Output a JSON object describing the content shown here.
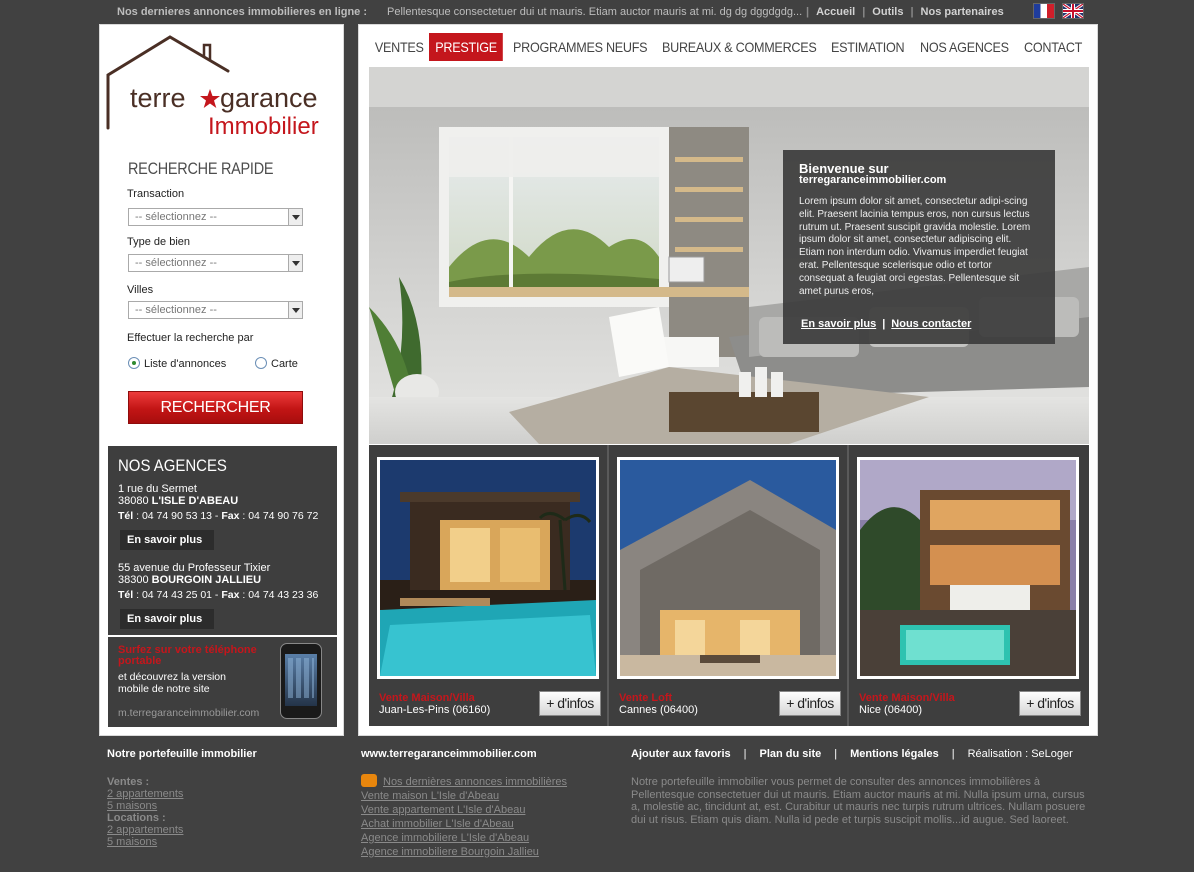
{
  "topbar": {
    "news_label": "Nos dernieres annonces immobilieres en ligne :",
    "news_text": "Pellentesque consectetuer dui ut mauris. Etiam auctor mauris at mi. dg dg dggdgdg...",
    "links": [
      "Accueil",
      "Outils",
      "Nos partenaires"
    ],
    "languages": [
      "fr",
      "en"
    ]
  },
  "logo": {
    "line1": "terre",
    "line2": "garance",
    "line3": "Immobilier"
  },
  "search": {
    "title": "RECHERCHE RAPIDE",
    "transaction_label": "Transaction",
    "transaction_value": "-- sélectionnez --",
    "type_label": "Type de bien",
    "type_value": "-- sélectionnez --",
    "villes_label": "Villes",
    "villes_value": "-- sélectionnez --",
    "mode_label": "Effectuer la recherche par",
    "mode_list": "Liste d'annonces",
    "mode_map": "Carte",
    "button": "RECHERCHER"
  },
  "agences": {
    "title": "NOS AGENCES",
    "items": [
      {
        "street": "1 rue du Sermet",
        "zip": "38080",
        "city": "L'ISLE D'ABEAU",
        "tel_label": "Tél",
        "tel": "04 74 90 53 13",
        "fax_label": "Fax",
        "fax": "04 74 90 76 72",
        "more": "En savoir plus"
      },
      {
        "street": "55 avenue du Professeur Tixier",
        "zip": "38300",
        "city": "BOURGOIN JALLIEU",
        "tel_label": "Tél",
        "tel": "04 74 43 25 01",
        "fax_label": "Fax",
        "fax": "04 74 43 23 36",
        "more": "En savoir plus"
      }
    ]
  },
  "mobile": {
    "headline": "Surfez sur votre téléphone portable",
    "text1": "et découvrez la version",
    "text2": "mobile de notre site",
    "url": "m.terregaranceimmobilier.com"
  },
  "nav": [
    "VENTES",
    "PRESTIGE",
    "PROGRAMMES NEUFS",
    "BUREAUX & COMMERCES",
    "ESTIMATION",
    "NOS AGENCES",
    "CONTACT"
  ],
  "welcome": {
    "title": "Bienvenue sur",
    "subtitle": "terregaranceimmobilier.com",
    "body": "Lorem ipsum dolor sit amet, consectetur adipi-scing elit. Praesent lacinia tempus eros, non cursus lectus rutrum ut. Praesent suscipit gravida molestie. Lorem ipsum dolor sit amet, consectetur adipiscing elit. Etiam non interdum odio. Vivamus imperdiet feugiat erat. Pellentesque scelerisque odio et tortor consequat a feugiat orci egestas. Pellentesque sit amet purus eros,",
    "link_more": "En savoir plus",
    "link_contact": "Nous contacter"
  },
  "properties": [
    {
      "type": "Vente Maison/Villa",
      "city": "Juan-Les-Pins (06160)",
      "button": "+ d'infos"
    },
    {
      "type": "Vente Loft",
      "city": "Cannes (06400)",
      "button": "+ d'infos"
    },
    {
      "type": "Vente Maison/Villa",
      "city": "Nice (06400)",
      "button": "+ d'infos"
    }
  ],
  "footer": {
    "col1_title": "Notre portefeuille immobilier",
    "ventes_label": "Ventes :",
    "ventes": [
      "2 appartements",
      "5 maisons"
    ],
    "locations_label": "Locations :",
    "locations": [
      "2 appartements",
      "5 maisons"
    ],
    "col2_title": "www.terregaranceimmobilier.com",
    "col2_links": [
      "Nos dernières annonces immobilières",
      "Vente maison L'Isle d'Abeau",
      "Vente appartement L'Isle d'Abeau",
      "Achat immobilier L'Isle d'Abeau",
      "Agence immobiliere L'Isle d'Abeau",
      "Agence immobiliere Bourgoin Jallieu"
    ],
    "links": [
      "Ajouter aux favoris",
      "Plan du site",
      "Mentions légales"
    ],
    "realisation": "Réalisation : SeLoger",
    "description": "Notre portefeuille immobilier vous permet de consulter des annonces immobilières à Pellentesque consectetuer dui ut mauris. Etiam auctor mauris at mi. Nulla ipsum urna, cursus a, molestie ac, tincidunt at, est. Curabitur ut mauris nec turpis rutrum ultrices. Nullam posuere dui ut risus. Etiam quis diam. Nulla id pede et turpis suscipit mollis...id augue. Sed laoreet."
  },
  "colors": {
    "accent": "#c4161c",
    "background": "#414141",
    "panel": "#3e3e3e"
  }
}
